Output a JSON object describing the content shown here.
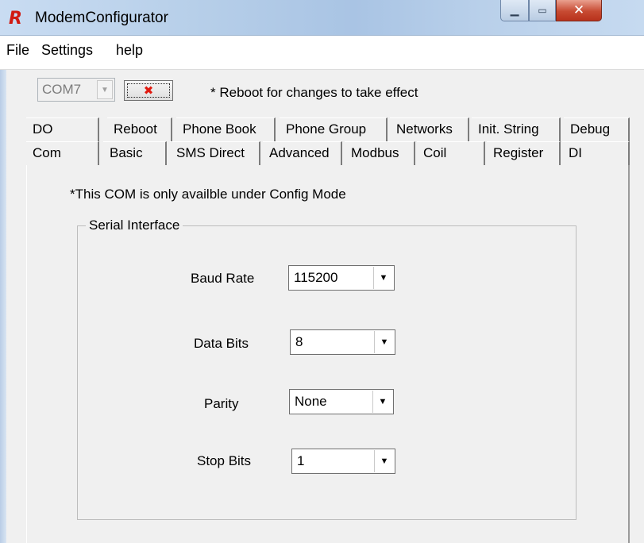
{
  "window": {
    "title": "ModemConfigurator",
    "app_icon_glyph": "R",
    "controls": {
      "minimize": "▁",
      "maximize": "▭",
      "close": "✕"
    }
  },
  "menu": {
    "items": [
      "File",
      "Settings",
      "help"
    ]
  },
  "toolbar": {
    "port_value": "COM7",
    "port_arrow": "▼",
    "close_port_glyph": "✖",
    "reboot_note": "* Reboot for changes to take effect"
  },
  "tabs": {
    "row1": [
      "DO",
      "Reboot",
      "Phone Book",
      "Phone Group",
      "Networks",
      "Init. String",
      "Debug"
    ],
    "row2": [
      "Com",
      "Basic",
      "SMS Direct",
      "Advanced",
      "Modbus",
      "Coil",
      "Register",
      "DI"
    ],
    "active": "Com"
  },
  "com_panel": {
    "note": "*This COM is only availble under Config Mode",
    "group_title": "Serial Interface",
    "fields": [
      {
        "label": "Baud Rate",
        "value": "115200"
      },
      {
        "label": "Data Bits",
        "value": "8"
      },
      {
        "label": "Parity",
        "value": "None"
      },
      {
        "label": "Stop Bits",
        "value": "1"
      }
    ],
    "dropdown_arrow": "▼"
  },
  "colors": {
    "close_button_red": "#c74a32",
    "titlebar_blue": "#b7cfe9",
    "panel_bg": "#f0f0f0"
  }
}
